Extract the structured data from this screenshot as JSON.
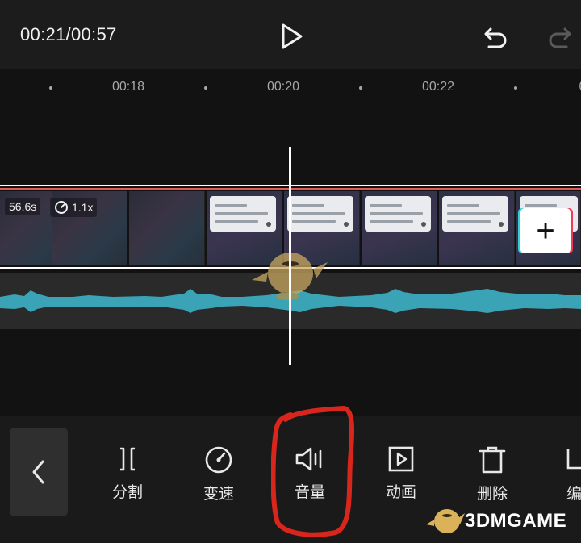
{
  "player": {
    "time": "00:21/00:57",
    "play_icon": "play-icon",
    "undo_icon": "undo-icon",
    "redo_icon": "redo-icon"
  },
  "ruler": {
    "ticks": [
      "00:18",
      "00:20",
      "00:22"
    ]
  },
  "clip": {
    "duration": "56.6s",
    "speed": "1.1x",
    "add_label": "+"
  },
  "toolbar": {
    "back_icon": "chevron-left-icon",
    "tools": [
      {
        "label": "分割",
        "icon": "split-icon"
      },
      {
        "label": "变速",
        "icon": "speed-icon"
      },
      {
        "label": "音量",
        "icon": "volume-icon"
      },
      {
        "label": "动画",
        "icon": "animation-icon"
      },
      {
        "label": "删除",
        "icon": "delete-icon"
      },
      {
        "label": "编",
        "icon": "edit-icon"
      }
    ]
  },
  "annotation": {
    "highlight_color": "#d8261c"
  },
  "watermark": {
    "text": "3DMGAME"
  },
  "colors": {
    "audio_wave": "#3aa3b5",
    "playhead": "#ffffff",
    "clip_border": "#ffffff"
  }
}
